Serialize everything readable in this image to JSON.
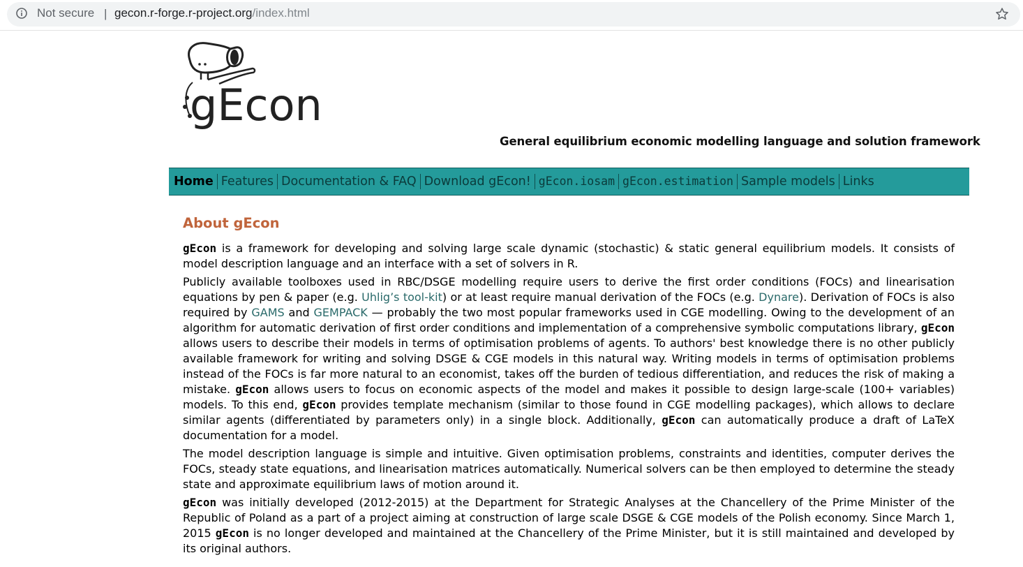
{
  "browser": {
    "security_label": "Not secure",
    "separator": "|",
    "url_host": "gecon.r-forge.r-project.org",
    "url_path": "/index.html",
    "info_icon": "info-circle-icon",
    "bookmark_icon": "star-icon"
  },
  "logo": {
    "text": "gEcon"
  },
  "tagline": "General equilibrium economic modelling language and solution framework",
  "nav": {
    "items": [
      {
        "label": "Home"
      },
      {
        "label": "Features"
      },
      {
        "label": "Documentation & FAQ"
      },
      {
        "label": "Download gEcon!"
      },
      {
        "label": "gEcon.iosam"
      },
      {
        "label": "gEcon.estimation"
      },
      {
        "label": "Sample models"
      },
      {
        "label": "Links"
      }
    ]
  },
  "colors": {
    "nav_background": "#249b9b",
    "heading": "#c0643b",
    "link": "#2a6a6a"
  },
  "main": {
    "heading": "About gEcon",
    "p1": {
      "brand": "gEcon",
      "text": " is a framework for developing and solving large scale dynamic (stochastic) & static general equilibrium models. It consists of model description language and an interface with a set of solvers in R."
    },
    "p2": {
      "t1": "Publicly available toolboxes used in RBC/DSGE modelling require users to derive the first order conditions (FOCs) and linearisation equations by pen & paper (e.g. ",
      "link_uhlig": "Uhlig’s tool-kit",
      "t2": ") or at least require manual derivation of the FOCs (e.g. ",
      "link_dynare": "Dynare",
      "t3": "). Derivation of FOCs is also required by ",
      "link_gams": "GAMS",
      "t4": " and ",
      "link_gempack": "GEMPACK",
      "t5": " — probably the two most popular frameworks used in CGE modelling. Owing to the development of an algorithm for automatic derivation of first order conditions and implementation of a comprehensive symbolic computations library, ",
      "brand1": "gEcon",
      "t6": " allows users to describe their models in terms of optimisation problems of agents. To authors' best knowledge there is no other publicly available framework for writing and solving DSGE & CGE models in this natural way. Writing models in terms of optimisation problems instead of the FOCs is far more natural to an economist, takes off the burden of tedious differentiation, and reduces the risk of making a mistake. ",
      "brand2": "gEcon",
      "t7": " allows users to focus on economic aspects of the model and makes it possible to design large-scale (100+ variables) models. To this end, ",
      "brand3": "gEcon",
      "t8": " provides template mechanism (similar to those found in CGE modelling packages), which allows to declare similar agents (differentiated by parameters only) in a single block. Additionally, ",
      "brand4": "gEcon",
      "t9": " can automatically produce a draft of LaTeX documentation for a model."
    },
    "p3": "The model description language is simple and intuitive. Given optimisation problems, constraints and identities, computer derives the FOCs, steady state equations, and linearisation matrices automatically. Numerical solvers can be then employed to determine the steady state and approximate equilibrium laws of motion around it.",
    "p4": {
      "brand1": "gEcon",
      "t1": " was initially developed (2012-2015) at the Department for Strategic Analyses at the Chancellery of the Prime Minister of the Republic of Poland as a part of a project aiming at construction of large scale DSGE & CGE models of the Polish economy. Since March 1, 2015 ",
      "brand2": "gEcon",
      "t2": " is no longer developed and maintained at the Chancellery of the Prime Minister, but it is still maintained and developed by its original authors."
    }
  }
}
